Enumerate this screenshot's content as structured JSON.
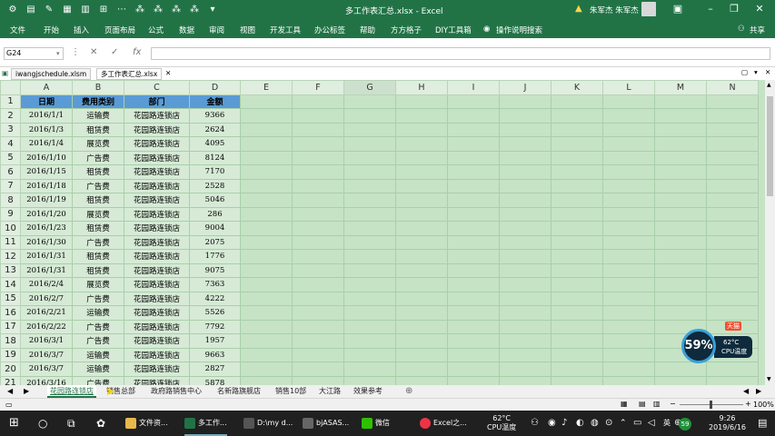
{
  "titlebar": {
    "title": "多工作表汇总.xlsx  -  Excel",
    "user": "朱军杰 朱军杰"
  },
  "menu": {
    "items": [
      "文件",
      "开始",
      "插入",
      "页面布局",
      "公式",
      "数据",
      "审阅",
      "视图",
      "开发工具",
      "办公标签",
      "帮助",
      "方方格子",
      "DIY工具箱",
      "操作说明搜索"
    ],
    "share": "共享"
  },
  "formula": {
    "namebox": "G24",
    "fx": "fx",
    "cancel": "✕",
    "enter": "✓"
  },
  "doc_tabs": [
    "iwangjschedule.xlsm",
    "多工作表汇总.xlsx"
  ],
  "columns": [
    "A",
    "B",
    "C",
    "D",
    "E",
    "F",
    "G",
    "H",
    "I",
    "J",
    "K",
    "L",
    "M",
    "N"
  ],
  "header_row": [
    "日期",
    "费用类别",
    "部门",
    "金额"
  ],
  "rows": [
    [
      "2016/1/1",
      "运输费",
      "花园路连锁店",
      "9366"
    ],
    [
      "2016/1/3",
      "租赁费",
      "花园路连锁店",
      "2624"
    ],
    [
      "2016/1/4",
      "展览费",
      "花园路连锁店",
      "4095"
    ],
    [
      "2016/1/10",
      "广告费",
      "花园路连锁店",
      "8124"
    ],
    [
      "2016/1/15",
      "租赁费",
      "花园路连锁店",
      "7170"
    ],
    [
      "2016/1/18",
      "广告费",
      "花园路连锁店",
      "2528"
    ],
    [
      "2016/1/19",
      "租赁费",
      "花园路连锁店",
      "5046"
    ],
    [
      "2016/1/20",
      "展览费",
      "花园路连锁店",
      "286"
    ],
    [
      "2016/1/23",
      "租赁费",
      "花园路连锁店",
      "9004"
    ],
    [
      "2016/1/30",
      "广告费",
      "花园路连锁店",
      "2075"
    ],
    [
      "2016/1/31",
      "租赁费",
      "花园路连锁店",
      "1776"
    ],
    [
      "2016/1/31",
      "租赁费",
      "花园路连锁店",
      "9075"
    ],
    [
      "2016/2/4",
      "展览费",
      "花园路连锁店",
      "7363"
    ],
    [
      "2016/2/7",
      "广告费",
      "花园路连锁店",
      "4222"
    ],
    [
      "2016/2/21",
      "运输费",
      "花园路连锁店",
      "5526"
    ],
    [
      "2016/2/22",
      "广告费",
      "花园路连锁店",
      "7792"
    ],
    [
      "2016/3/1",
      "广告费",
      "花园路连锁店",
      "1957"
    ],
    [
      "2016/3/7",
      "运输费",
      "花园路连锁店",
      "9663"
    ],
    [
      "2016/3/7",
      "运输费",
      "花园路连锁店",
      "2827"
    ],
    [
      "2016/3/16",
      "广告费",
      "花园路连锁店",
      "5878"
    ],
    [
      "2016/3/30",
      "展览费",
      "花园路连锁店",
      "8614"
    ]
  ],
  "sheets": [
    "花园路连锁店",
    "销售总部",
    "政府路销售中心",
    "名新路旗舰店",
    "销售10部",
    "大江路",
    "效果参考"
  ],
  "status": {
    "zoom": "100%"
  },
  "cpu": {
    "percent": "59%",
    "temp": "62°C",
    "label": "CPU温度",
    "badge": "天猫"
  },
  "taskbar": {
    "apps": [
      "文件资...",
      "多工作...",
      "D:\\my d...",
      "bjASAS...",
      "微信",
      "Excel之..."
    ],
    "cpu_temp": "62°C",
    "cpu_label": "CPU温度",
    "ime": "英",
    "badge": "59",
    "time": "9:26",
    "date": "2019/6/16"
  },
  "colors": {
    "excel_green": "#217346",
    "grid_bg": "#c6e3c6",
    "header_blue": "#5a9bd5"
  }
}
